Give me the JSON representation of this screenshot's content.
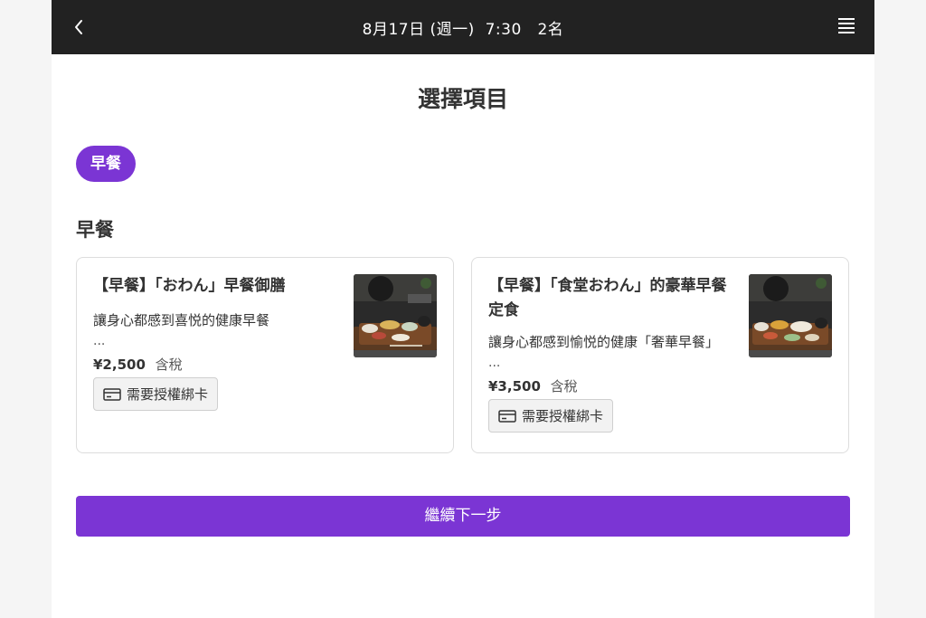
{
  "header": {
    "title": "8月17日 (週一)  7:30   2名",
    "back_icon": "chevron-left-icon",
    "menu_icon": "hamburger-menu-icon"
  },
  "page": {
    "title": "選擇項目"
  },
  "categories": [
    {
      "label": "早餐",
      "selected": true
    }
  ],
  "section": {
    "title": "早餐"
  },
  "items": [
    {
      "name": "【早餐】「おわん」早餐御膳",
      "description": "讓身心都感到喜悦的健康早餐",
      "ellipsis": "...",
      "price": "¥2,500",
      "tax": "含稅",
      "badge": "需要授權綁卡",
      "badge_icon": "credit-card-icon",
      "image": "breakfast-tray-photo"
    },
    {
      "name": "【早餐】「食堂おわん」的豪華早餐定食",
      "description": "讓身心都感到愉悦的健康「奢華早餐」",
      "ellipsis": "...",
      "price": "¥3,500",
      "tax": "含稅",
      "badge": "需要授權綁卡",
      "badge_icon": "credit-card-icon",
      "image": "breakfast-tray-photo"
    }
  ],
  "actions": {
    "continue_label": "繼續下一步"
  },
  "colors": {
    "accent": "#7b35d4",
    "topbar_bg": "#222222",
    "page_bg": "#f5f5f5"
  }
}
